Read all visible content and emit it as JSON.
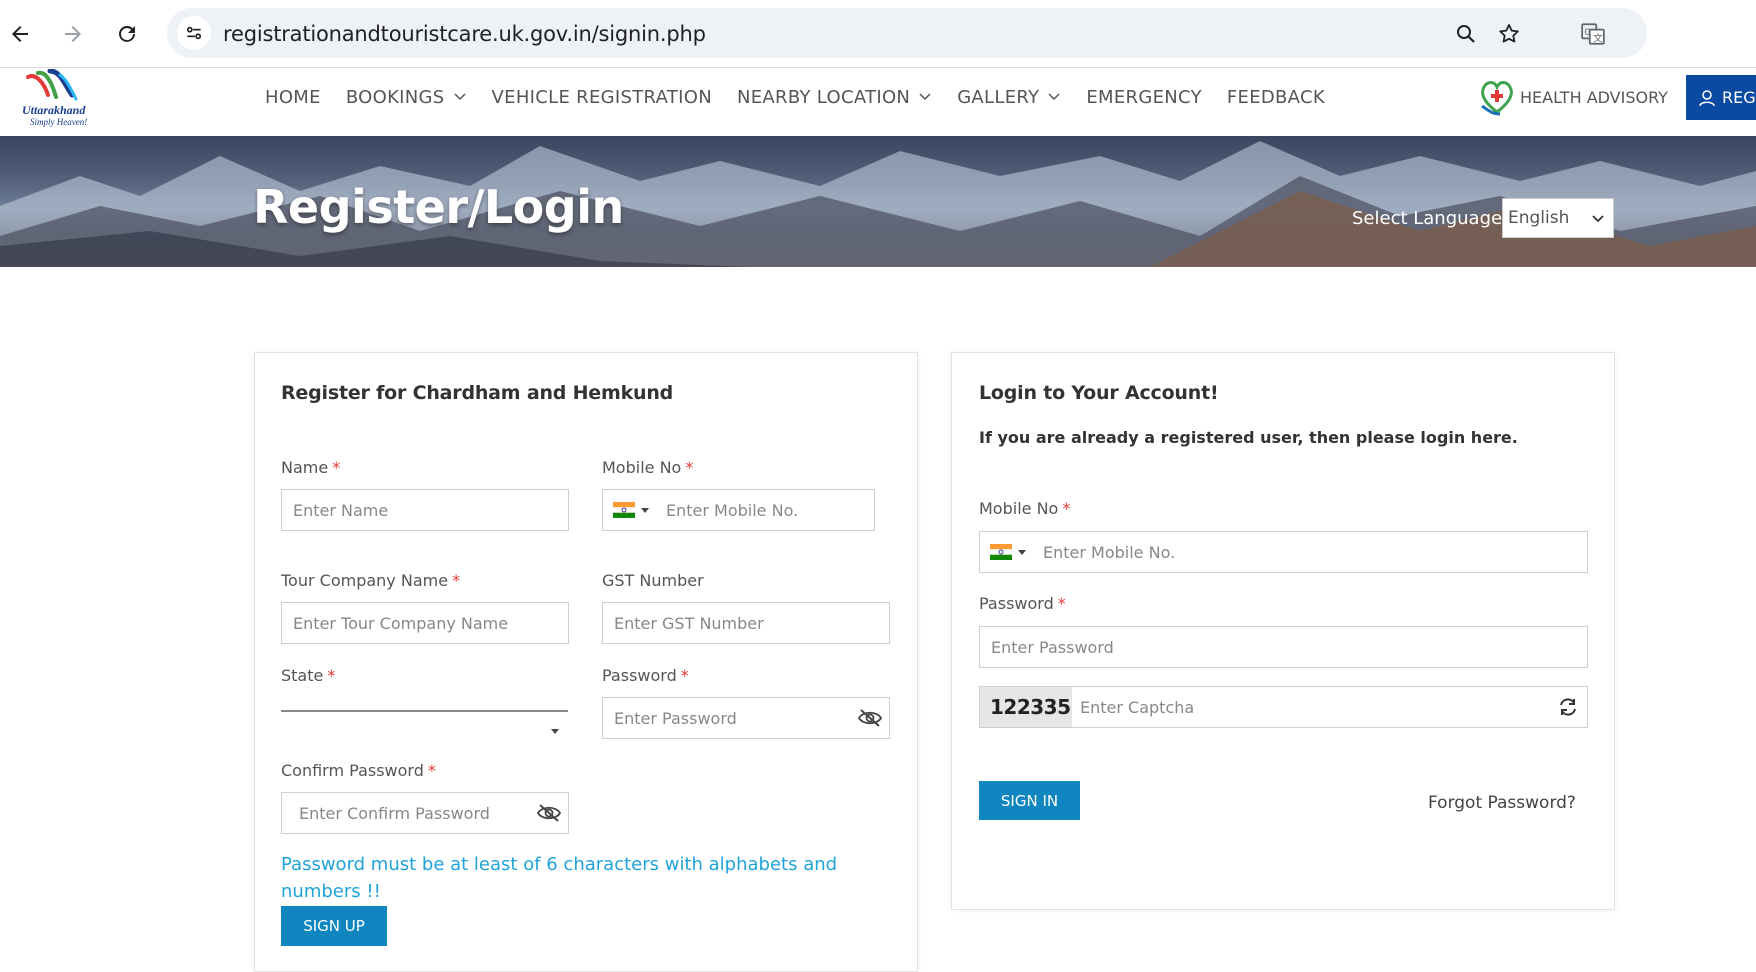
{
  "browser": {
    "url": "registrationandtouristcare.uk.gov.in/signin.php"
  },
  "header": {
    "logo_name": "Uttarakhand",
    "logo_tagline": "Simply Heaven!",
    "menu": [
      "HOME",
      "BOOKINGS",
      "VEHICLE REGISTRATION",
      "NEARBY LOCATION",
      "GALLERY",
      "EMERGENCY",
      "FEEDBACK"
    ],
    "health_advisory": "HEALTH ADVISORY",
    "register_label": "REGI"
  },
  "banner": {
    "title": "Register/Login",
    "language_label": "Select Language",
    "language_value": "English"
  },
  "register": {
    "title": "Register for Chardham and Hemkund",
    "name_label": "Name",
    "name_placeholder": "Enter Name",
    "mobile_label": "Mobile No",
    "mobile_placeholder": "Enter  Mobile No.",
    "company_label": "Tour Company Name",
    "company_placeholder": "Enter Tour Company Name",
    "gst_label": "GST Number",
    "gst_placeholder": "Enter GST Number",
    "state_label": "State",
    "password_label": "Password",
    "password_placeholder": "Enter  Password",
    "confirm_label": "Confirm Password",
    "confirm_placeholder": "Enter Confirm Password",
    "hint": "Password must be at least of 6 characters with alphabets and numbers !!",
    "signup_label": "SIGN UP",
    "required_mark": "*"
  },
  "login": {
    "title": "Login to Your Account!",
    "subtitle": "If you are already a registered user, then please login here.",
    "mobile_label": "Mobile No",
    "mobile_placeholder": "Enter  Mobile No.",
    "password_label": "Password",
    "password_placeholder": "Enter  Password",
    "captcha_code": "122335",
    "captcha_placeholder": "Enter Captcha",
    "signin_label": "SIGN IN",
    "forgot_label": "Forgot Password?"
  },
  "colors": {
    "brand_blue": "#0b4aa2",
    "button_blue": "#0f86c0",
    "hint_cyan": "#1fa3d8",
    "required_red": "#e53935"
  }
}
